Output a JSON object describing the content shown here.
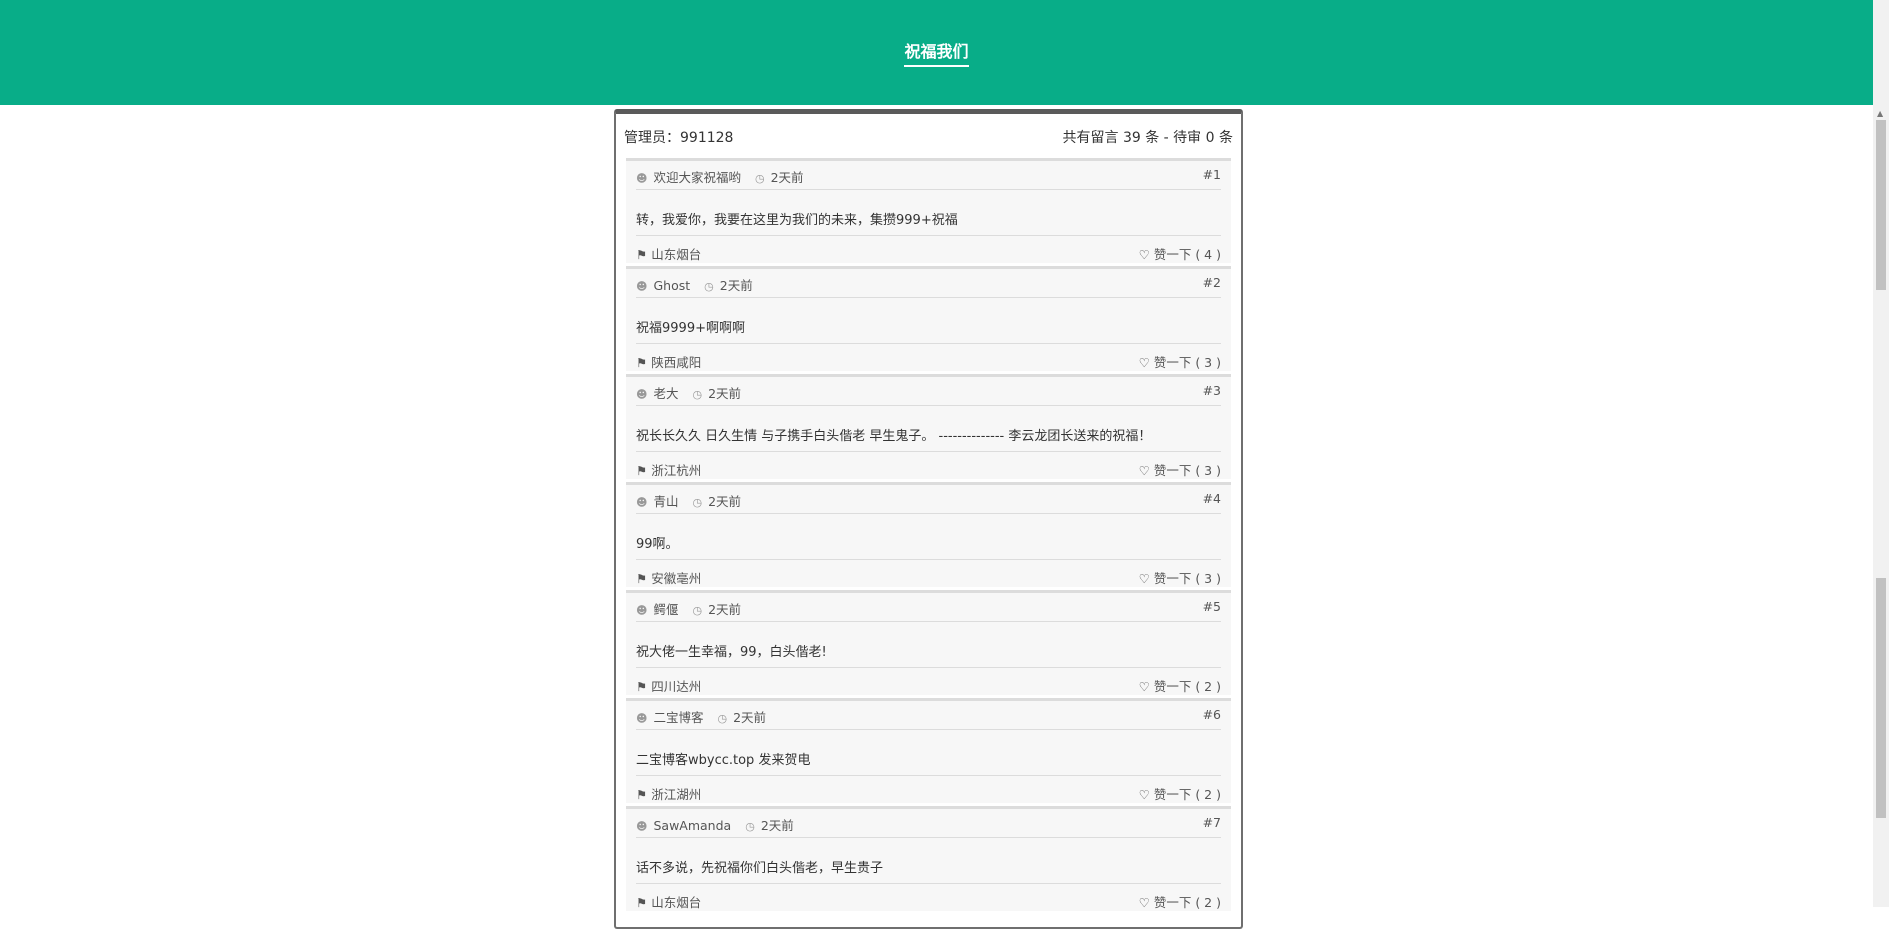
{
  "header": {
    "title": "祝福我们"
  },
  "panel": {
    "admin": "管理员：991128",
    "stats": "共有留言 39 条 - 待审 0 条"
  },
  "messages": [
    {
      "name": "欢迎大家祝福哟",
      "time": "2天前",
      "num": "#1",
      "body": "转，我爱你，我要在这里为我们的未来，集攒999+祝福",
      "loc": "山东烟台",
      "like": "赞一下 ( 4 )"
    },
    {
      "name": "Ghost",
      "time": "2天前",
      "num": "#2",
      "body": "祝福9999+啊啊啊",
      "loc": "陕西咸阳",
      "like": "赞一下 ( 3 )"
    },
    {
      "name": "老大",
      "time": "2天前",
      "num": "#3",
      "body": "祝长长久久 日久生情 与子携手白头偕老 早生鬼子。 -------------- 李云龙团长送来的祝福！",
      "loc": "浙江杭州",
      "like": "赞一下 ( 3 )"
    },
    {
      "name": "青山",
      "time": "2天前",
      "num": "#4",
      "body": "99啊。",
      "loc": "安徽亳州",
      "like": "赞一下 ( 3 )"
    },
    {
      "name": "鳄偃",
      "time": "2天前",
      "num": "#5",
      "body": "祝大佬一生幸福，99，白头偕老!",
      "loc": "四川达州",
      "like": "赞一下 ( 2 )"
    },
    {
      "name": "二宝博客",
      "time": "2天前",
      "num": "#6",
      "body": "二宝博客wbycc.top 发来贺电",
      "loc": "浙江湖州",
      "like": "赞一下 ( 2 )"
    },
    {
      "name": "SawAmanda",
      "time": "2天前",
      "num": "#7",
      "body": "话不多说，先祝福你们白头偕老，早生贵子",
      "loc": "山东烟台",
      "like": "赞一下 ( 2 )"
    }
  ]
}
